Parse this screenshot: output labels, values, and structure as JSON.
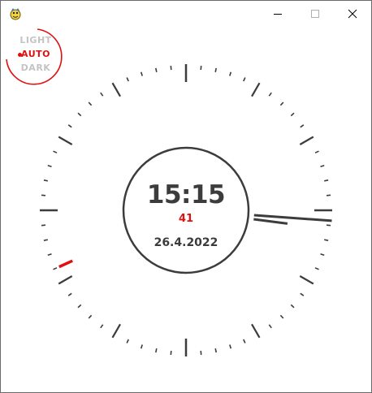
{
  "window": {
    "controls": {
      "minimize_icon": "minimize-icon",
      "maximize_icon": "maximize-icon",
      "close_icon": "close-icon"
    }
  },
  "theme": {
    "options": [
      "LIGHT",
      "AUTO",
      "DARK"
    ],
    "selected": "AUTO",
    "accent": "#e01010"
  },
  "clock": {
    "time": "15:15",
    "seconds": "41",
    "date": "26.4.2022",
    "hands": {
      "hour": 3.25,
      "minute": 15,
      "second": 41
    },
    "colors": {
      "ink": "#3c3c3c",
      "second_hand": "#e01010"
    }
  }
}
